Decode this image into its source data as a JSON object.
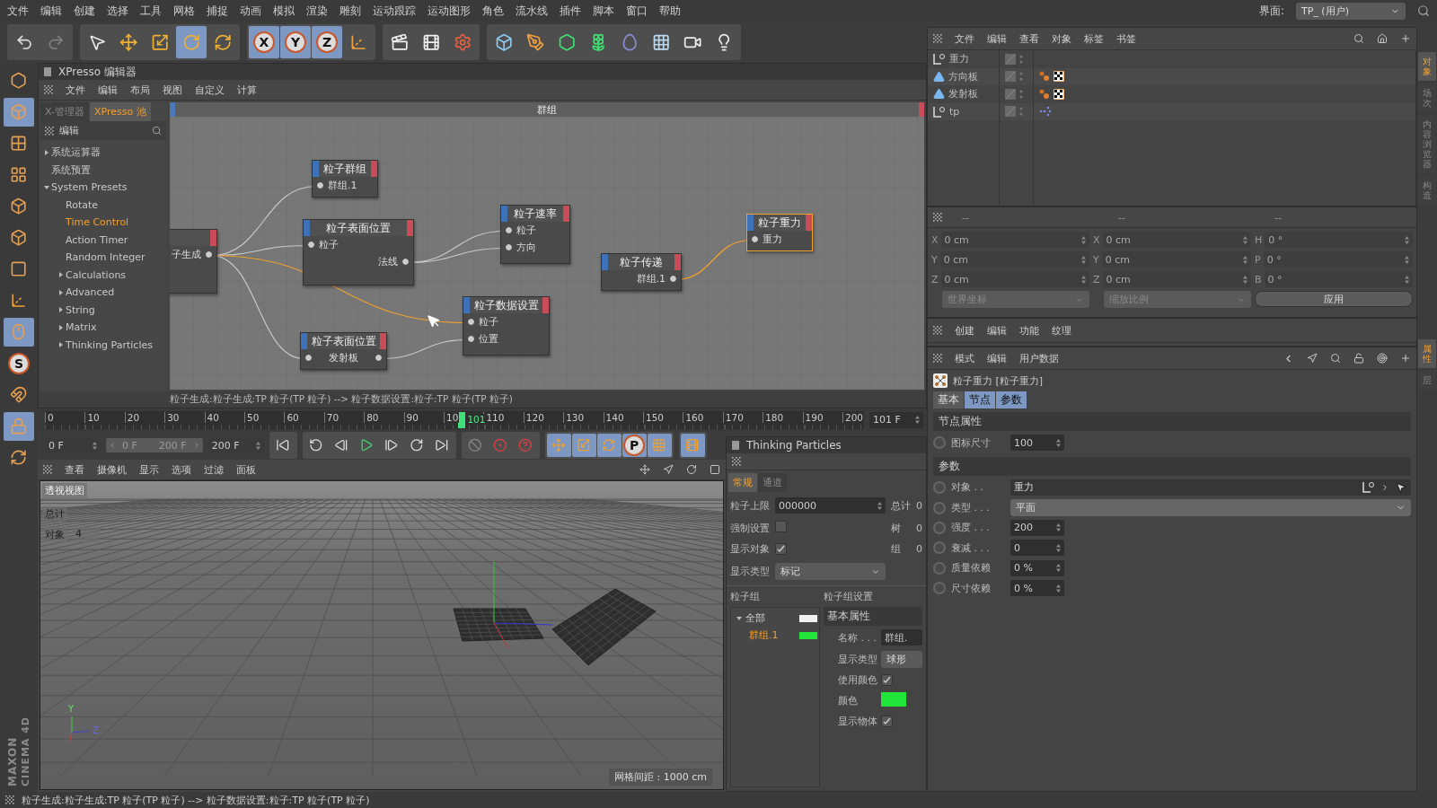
{
  "menu_bar": {
    "items": [
      "文件",
      "编辑",
      "创建",
      "选择",
      "工具",
      "网格",
      "捕捉",
      "动画",
      "模拟",
      "渲染",
      "雕刻",
      "运动跟踪",
      "运动图形",
      "角色",
      "流水线",
      "插件",
      "脚本",
      "窗口",
      "帮助"
    ],
    "layout_label": "界面:",
    "layout_value": "TP_ (用户)"
  },
  "toolbar": [
    {
      "kind": "icon",
      "selected": false
    },
    {
      "kind": "icon",
      "selected": false,
      "disabled": true
    },
    {
      "kind": "icon",
      "selected": false
    },
    {
      "kind": "icon",
      "selected": false
    },
    {
      "kind": "icon",
      "selected": false
    },
    {
      "kind": "icon",
      "selected": true
    },
    {
      "kind": "icon",
      "selected": false
    },
    {
      "kind": "letter",
      "label": "X",
      "selected": true
    },
    {
      "kind": "letter",
      "label": "Y",
      "selected": true
    },
    {
      "kind": "letter",
      "label": "Z",
      "selected": true
    },
    {
      "kind": "icon",
      "selected": false
    },
    {
      "kind": "icon",
      "selected": false
    },
    {
      "kind": "icon",
      "selected": false
    },
    {
      "kind": "icon",
      "selected": false
    },
    {
      "kind": "icon",
      "selected": false
    },
    {
      "kind": "icon",
      "selected": false
    },
    {
      "kind": "icon",
      "selected": false
    },
    {
      "kind": "icon",
      "selected": false
    },
    {
      "kind": "icon",
      "selected": false
    },
    {
      "kind": "icon",
      "selected": false
    },
    {
      "kind": "icon",
      "selected": false
    },
    {
      "kind": "icon",
      "selected": false
    }
  ],
  "left_tools": [
    {
      "kind": "icon",
      "selected": false
    },
    {
      "kind": "icon",
      "selected": true
    },
    {
      "kind": "icon",
      "selected": false
    },
    {
      "kind": "icon",
      "selected": false
    },
    {
      "kind": "icon",
      "selected": false
    },
    {
      "kind": "icon",
      "selected": false
    },
    {
      "kind": "icon",
      "selected": false
    },
    {
      "kind": "icon",
      "selected": false
    },
    {
      "kind": "icon",
      "selected": true
    },
    {
      "kind": "letter",
      "label": "S",
      "selected": false
    },
    {
      "kind": "icon",
      "selected": false
    },
    {
      "kind": "icon",
      "selected": true
    },
    {
      "kind": "icon",
      "selected": false
    }
  ],
  "logo": {
    "line1": "MAXON",
    "line2": "CINEMA 4D"
  },
  "xpresso": {
    "title": "XPresso 编辑器",
    "menu": [
      "文件",
      "编辑",
      "布局",
      "视图",
      "自定义",
      "计算"
    ],
    "tabs": [
      {
        "label": "X-管理器",
        "selected": false
      },
      {
        "label": "XPresso 池",
        "selected": true
      }
    ],
    "pool_header": "编辑",
    "tree": [
      {
        "label": "系统运算器",
        "expanded": false,
        "selected": false
      },
      {
        "label": "系统预置",
        "selected": false
      },
      {
        "label": "System Presets",
        "expanded": true,
        "selected": false,
        "children": [
          {
            "label": "Rotate",
            "selected": false
          },
          {
            "label": "Time Control",
            "selected": true
          },
          {
            "label": "Action Timer",
            "selected": false
          },
          {
            "label": "Random Integer",
            "selected": false
          },
          {
            "label": "Calculations",
            "expanded": false,
            "selected": false
          },
          {
            "label": "Advanced",
            "expanded": false,
            "selected": false
          },
          {
            "label": "String",
            "expanded": false,
            "selected": false
          },
          {
            "label": "Matrix",
            "expanded": false,
            "selected": false
          },
          {
            "label": "Thinking Particles",
            "expanded": false,
            "selected": false
          }
        ]
      }
    ],
    "graph_title": "群组",
    "nodes": [
      {
        "rows": [
          {
            "label": "子生成",
            "kind": "out"
          }
        ],
        "selected": false
      },
      {
        "title": "粒子群组",
        "rows": [
          {
            "label": "群组.1",
            "kind": "in"
          }
        ],
        "selected": false
      },
      {
        "title": "粒子表面位置",
        "rows": [
          {
            "label": "粒子",
            "kind": "in"
          },
          {
            "label": "法线",
            "kind": "out"
          }
        ],
        "selected": false
      },
      {
        "title": "粒子速率",
        "rows": [
          {
            "label": "粒子",
            "kind": "in"
          },
          {
            "label": "方向",
            "kind": "in"
          }
        ],
        "selected": false
      },
      {
        "title": "粒子传递",
        "rows": [
          {
            "label": "群组.1",
            "kind": "out"
          }
        ],
        "selected": false
      },
      {
        "title": "粒子重力",
        "rows": [
          {
            "label": "重力",
            "kind": "in"
          }
        ],
        "selected": true
      },
      {
        "title": "粒子数据设置",
        "rows": [
          {
            "label": "粒子",
            "kind": "in"
          },
          {
            "label": "位置",
            "kind": "in"
          }
        ],
        "selected": false
      },
      {
        "title": "粒子表面位置",
        "rows": [
          {
            "label": "发射板",
            "kind": "both"
          }
        ],
        "selected": false
      }
    ],
    "info": "粒子生成:粒子生成:TP 粒子(TP 粒子) --> 粒子数据设置:粒子:TP 粒子(TP 粒子)"
  },
  "timeline": {
    "ticks": [
      "0",
      "10",
      "20",
      "30",
      "40",
      "50",
      "60",
      "70",
      "80",
      "90",
      "10",
      "110",
      "120",
      "130",
      "140",
      "150",
      "160",
      "170",
      "180",
      "190",
      "200"
    ],
    "playhead": {
      "label": "101",
      "level": 0.505
    },
    "frame": "101 F"
  },
  "transport": {
    "start": "0 F",
    "range_start": "0 F",
    "range_end": "200 F",
    "end": "200 F",
    "buttons": [
      {
        "kind": "icon",
        "selected": false
      },
      {
        "kind": "icon",
        "selected": false
      },
      {
        "kind": "icon",
        "selected": false
      },
      {
        "kind": "icon",
        "selected": false
      },
      {
        "kind": "icon",
        "selected": false
      },
      {
        "kind": "icon",
        "selected": false
      },
      {
        "kind": "icon",
        "selected": false
      },
      {
        "kind": "icon",
        "selected": false
      },
      {
        "kind": "icon",
        "selected": false
      },
      {
        "kind": "icon",
        "selected": false
      },
      {
        "kind": "icon",
        "selected": true
      },
      {
        "kind": "icon",
        "selected": true
      },
      {
        "kind": "icon",
        "selected": true
      },
      {
        "kind": "letter",
        "label": "P",
        "selected": true
      },
      {
        "kind": "icon",
        "selected": true
      },
      {
        "kind": "icon",
        "selected": true
      }
    ]
  },
  "viewport": {
    "menu": [
      "查看",
      "摄像机",
      "显示",
      "选项",
      "过滤",
      "面板"
    ],
    "label": "透视视图",
    "hud": [
      {
        "label": "总计"
      },
      {
        "label": "对象",
        "value": "4"
      }
    ],
    "axis_labels": [
      "Y",
      "Z"
    ],
    "grid_spacing": "网格间距 : 1000 cm"
  },
  "tp_panel": {
    "title": "Thinking Particles",
    "tabs": [
      {
        "label": "常规",
        "selected": true
      },
      {
        "label": "通道",
        "selected": false
      }
    ],
    "settings": [
      {
        "label": "粒子上限",
        "kind": "number",
        "value": "000000"
      },
      {
        "label": "强制设置",
        "kind": "check",
        "checked": false
      },
      {
        "label": "显示对象",
        "kind": "check",
        "checked": true
      },
      {
        "label": "显示类型",
        "kind": "dropdown",
        "value": "标记"
      }
    ],
    "stats": [
      {
        "label": "总计",
        "value": "0"
      },
      {
        "label": "树",
        "value": "0"
      },
      {
        "label": "组",
        "value": "0"
      }
    ],
    "groups_label": "粒子组",
    "group_settings_label": "粒子组设置",
    "groups": [
      {
        "label": "全部",
        "color": "#f0f0f0",
        "expanded": true,
        "selected": false,
        "children": [
          {
            "label": "群组.1",
            "color": "#22e53a",
            "selected": true
          }
        ]
      }
    ],
    "group_header": "基本属性",
    "group_props": [
      {
        "label": "名称 . . .",
        "kind": "text",
        "value": "群组."
      },
      {
        "label": "显示类型",
        "kind": "button",
        "value": "球形"
      },
      {
        "label": "使用颜色",
        "kind": "check",
        "checked": true
      },
      {
        "label": "颜色",
        "kind": "swatch",
        "color": "#22e53a"
      },
      {
        "label": "显示物体",
        "kind": "check",
        "checked": true
      }
    ]
  },
  "object_manager": {
    "menu": [
      "文件",
      "编辑",
      "查看",
      "对象",
      "标签",
      "书签"
    ],
    "objects": [
      {
        "name": "重力",
        "kind": "null"
      },
      {
        "name": "方向板",
        "kind": "emitter",
        "tags": [
          {
            "kind": "particle"
          },
          {
            "kind": "texture"
          }
        ]
      },
      {
        "name": "发射板",
        "kind": "emitter",
        "tags": [
          {
            "kind": "particle"
          },
          {
            "kind": "texture"
          }
        ]
      },
      {
        "name": "tp",
        "kind": "null",
        "tags": [
          {
            "kind": "xpresso"
          }
        ]
      }
    ]
  },
  "coordinates": {
    "headers": [
      "--",
      "--",
      "--"
    ],
    "columns": [
      [
        {
          "axis": "X",
          "value": "0 cm"
        },
        {
          "axis": "Y",
          "value": "0 cm"
        },
        {
          "axis": "Z",
          "value": "0 cm"
        }
      ],
      [
        {
          "axis": "X",
          "value": "0 cm"
        },
        {
          "axis": "Y",
          "value": "0 cm"
        },
        {
          "axis": "Z",
          "value": "0 cm"
        }
      ],
      [
        {
          "axis": "H",
          "value": "0 °"
        },
        {
          "axis": "P",
          "value": "0 °"
        },
        {
          "axis": "B",
          "value": "0 °"
        }
      ]
    ],
    "dropdowns": [
      "世界坐标",
      "缩放比例"
    ],
    "apply": "应用"
  },
  "materials": {
    "menu": [
      "创建",
      "编辑",
      "功能",
      "纹理"
    ]
  },
  "attributes": {
    "menu": [
      "模式",
      "编辑",
      "用户数据"
    ],
    "title": "粒子重力 [粒子重力]",
    "tabs": [
      {
        "label": "基本",
        "selected": false
      },
      {
        "label": "节点",
        "selected": true
      },
      {
        "label": "参数",
        "selected": true
      }
    ],
    "sections": [
      {
        "title": "节点属性",
        "rows": [
          {
            "label": "图标尺寸",
            "kind": "number",
            "value": "100",
            "keyframed": false
          }
        ]
      },
      {
        "title": "参数",
        "rows": [
          {
            "label": "对象 . .",
            "kind": "link",
            "value": "重力",
            "keyframed": false
          },
          {
            "label": "类型 . . .",
            "kind": "dropdown",
            "value": "平面",
            "keyframed": false
          },
          {
            "label": "强度 . . .",
            "kind": "number",
            "value": "200",
            "keyframed": false
          },
          {
            "label": "衰减 . . .",
            "kind": "number",
            "value": "0",
            "keyframed": false
          },
          {
            "label": "质量依赖",
            "kind": "number",
            "value": "0 %",
            "keyframed": false
          },
          {
            "label": "尺寸依赖",
            "kind": "number",
            "value": "0 %",
            "keyframed": false
          }
        ]
      }
    ]
  },
  "side_tabs_top": [
    {
      "label": "对象",
      "selected": true
    },
    {
      "label": "场次",
      "selected": false
    },
    {
      "label": "内容浏览器",
      "selected": false
    },
    {
      "label": "构造",
      "selected": false
    }
  ],
  "side_tabs_bottom": [
    {
      "label": "属性",
      "selected": true
    },
    {
      "label": "层",
      "selected": false
    }
  ],
  "status_bar": "粒子生成:粒子生成:TP 粒子(TP 粒子) --> 粒子数据设置:粒子:TP 粒子(TP 粒子)"
}
